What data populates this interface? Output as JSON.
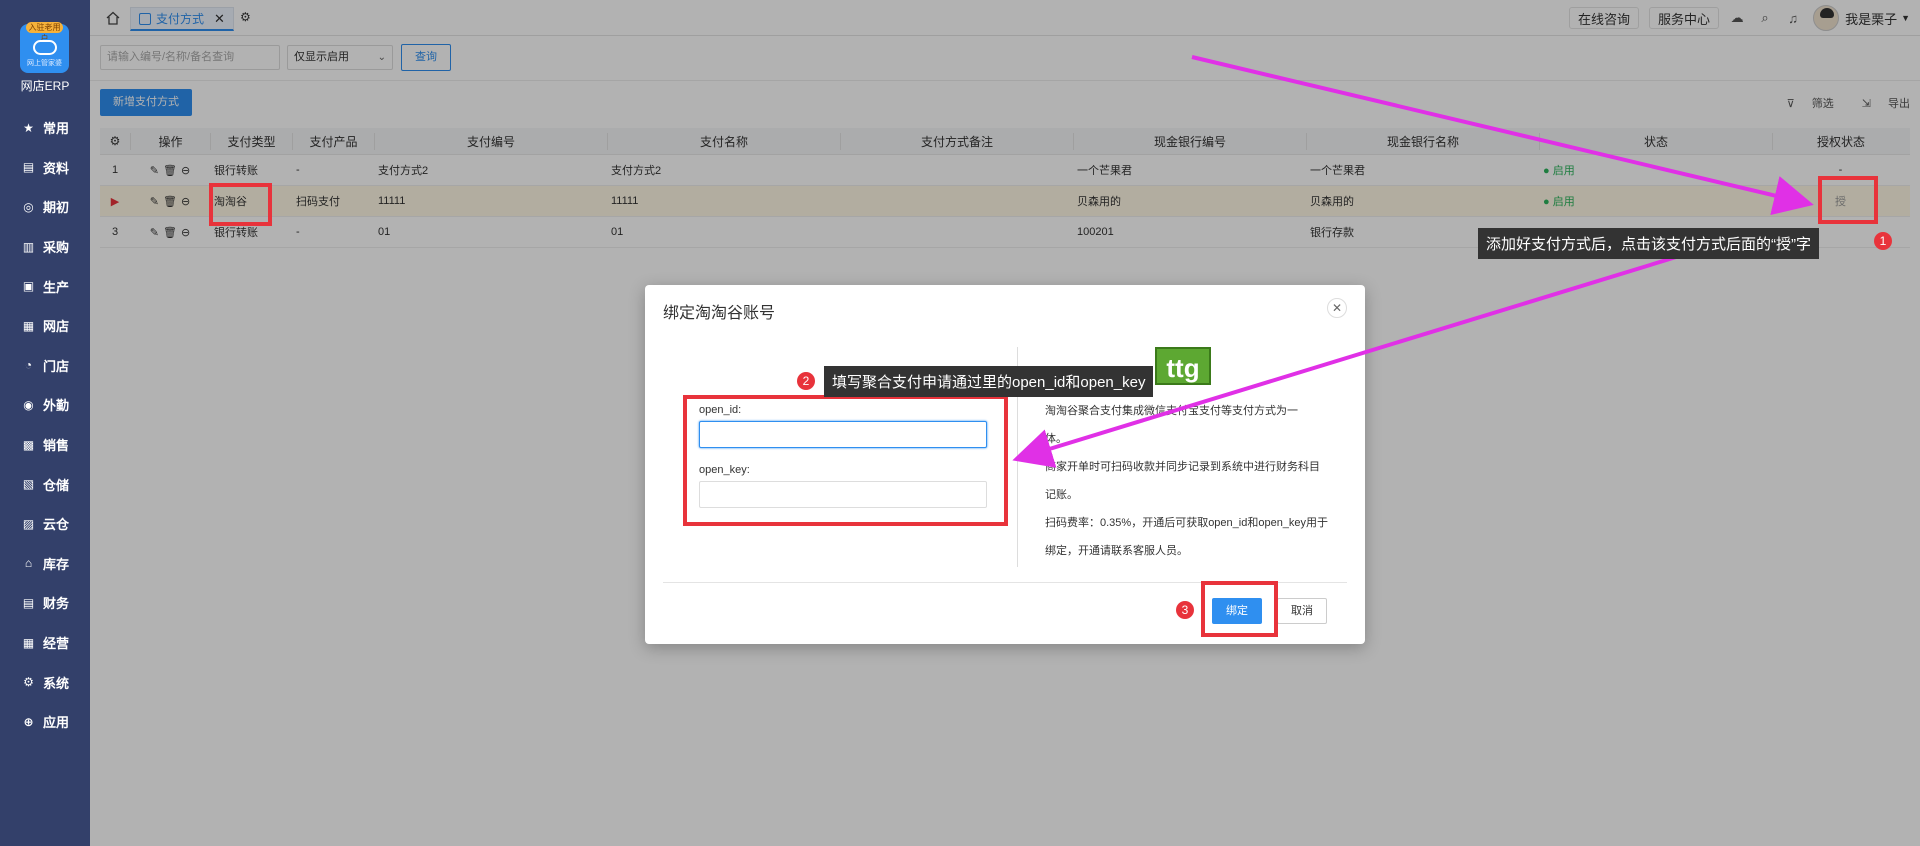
{
  "sidebar": {
    "logo_badge": "入驻老用户",
    "logo_sub": "网上管家婆",
    "app_name": "网店ERP",
    "items": [
      {
        "label": "常用",
        "icon": "star-icon"
      },
      {
        "label": "资料",
        "icon": "file-icon"
      },
      {
        "label": "期初",
        "icon": "period-icon"
      },
      {
        "label": "采购",
        "icon": "purchase-icon"
      },
      {
        "label": "生产",
        "icon": "production-icon"
      },
      {
        "label": "网店",
        "icon": "shop-icon"
      },
      {
        "label": "门店",
        "icon": "store-icon"
      },
      {
        "label": "外勤",
        "icon": "field-icon"
      },
      {
        "label": "销售",
        "icon": "sales-icon"
      },
      {
        "label": "仓储",
        "icon": "warehouse-icon"
      },
      {
        "label": "云仓",
        "icon": "cloud-warehouse-icon"
      },
      {
        "label": "库存",
        "icon": "inventory-icon"
      },
      {
        "label": "财务",
        "icon": "finance-icon"
      },
      {
        "label": "经营",
        "icon": "business-icon"
      },
      {
        "label": "系统",
        "icon": "system-icon"
      },
      {
        "label": "应用",
        "icon": "apps-icon"
      }
    ]
  },
  "topbar": {
    "tab_label": "支付方式",
    "online_consult": "在线咨询",
    "service_center": "服务中心",
    "user_name": "我是栗子"
  },
  "filter": {
    "search_placeholder": "请输入编号/名称/备名查询",
    "status_select": "仅显示启用",
    "query_label": "查询"
  },
  "toolbar": {
    "add_label": "新增支付方式",
    "filter_label": "筛选",
    "export_label": "导出"
  },
  "grid": {
    "headers": [
      "",
      "操作",
      "支付类型",
      "支付产品",
      "支付编号",
      "支付名称",
      "支付方式备注",
      "现金银行编号",
      "现金银行名称",
      "状态",
      "授权状态"
    ],
    "rows": [
      {
        "idx": "1",
        "type": "银行转账",
        "product": "-",
        "code": "支付方式2",
        "name": "支付方式2",
        "note": "",
        "bank_code": "一个芒果君",
        "bank_name": "一个芒果君",
        "status": "启用",
        "auth": "-"
      },
      {
        "idx": "",
        "type": "淘淘谷",
        "product": "扫码支付",
        "code": "11111",
        "name": "11111",
        "note": "",
        "bank_code": "贝森用的",
        "bank_name": "贝森用的",
        "status": "启用",
        "auth": "授"
      },
      {
        "idx": "3",
        "type": "银行转账",
        "product": "-",
        "code": "01",
        "name": "01",
        "note": "",
        "bank_code": "100201",
        "bank_name": "银行存款",
        "status": "",
        "auth": ""
      }
    ]
  },
  "modal": {
    "title": "绑定淘淘谷账号",
    "open_id_label": "open_id:",
    "open_key_label": "open_key:",
    "logo_text": "ttg",
    "desc": [
      "淘淘谷聚合支付集成微信支付宝支付等支付方式为一",
      "体。",
      "商家开单时可扫码收款并同步记录到系统中进行财务科目",
      "记账。",
      "扫码费率：0.35%，开通后可获取open_id和open_key用于",
      "绑定，开通请联系客服人员。"
    ],
    "bind_label": "绑定",
    "cancel_label": "取消"
  },
  "annotations": {
    "step1": "添加好支付方式后，点击该支付方式后面的“授”字",
    "step2": "填写聚合支付申请通过里的open_id和open_key",
    "n1": "1",
    "n2": "2",
    "n3": "3"
  },
  "colors": {
    "sidebar_bg": "#33406a",
    "accent": "#2f8ff0",
    "highlight": "#e8333b",
    "arrow": "#e030e6"
  }
}
